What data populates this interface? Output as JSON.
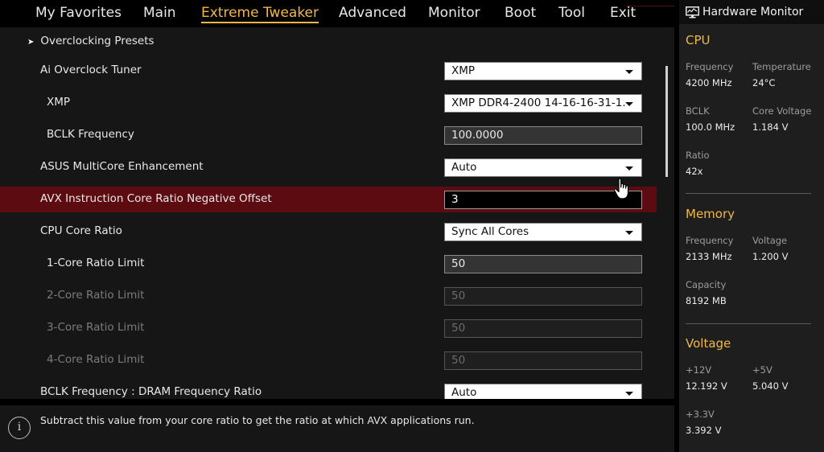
{
  "menu": {
    "tabs": [
      {
        "label": "My Favorites",
        "active": false
      },
      {
        "label": "Main",
        "active": false
      },
      {
        "label": "Extreme Tweaker",
        "active": true
      },
      {
        "label": "Advanced",
        "active": false
      },
      {
        "label": "Monitor",
        "active": false
      },
      {
        "label": "Boot",
        "active": false
      },
      {
        "label": "Tool",
        "active": false
      },
      {
        "label": "Exit",
        "active": false
      }
    ]
  },
  "main": {
    "preset": "Overclocking Presets",
    "rows": [
      {
        "label": "Ai Overclock Tuner",
        "control": "select",
        "value": "XMP"
      },
      {
        "label": "XMP",
        "control": "select",
        "value": "XMP DDR4-2400 14-16-16-31-1."
      },
      {
        "label": "BCLK Frequency",
        "control": "input",
        "value": "100.0000"
      },
      {
        "label": "ASUS MultiCore Enhancement",
        "control": "select",
        "value": "Auto"
      },
      {
        "label": "AVX Instruction Core Ratio Negative Offset",
        "control": "input",
        "value": "3",
        "selected": true
      },
      {
        "label": "CPU Core Ratio",
        "control": "select",
        "value": "Sync All Cores"
      },
      {
        "label": "1-Core Ratio Limit",
        "control": "input",
        "value": "50"
      },
      {
        "label": "2-Core Ratio Limit",
        "control": "input",
        "value": "50",
        "disabled": true
      },
      {
        "label": "3-Core Ratio Limit",
        "control": "input",
        "value": "50",
        "disabled": true
      },
      {
        "label": "4-Core Ratio Limit",
        "control": "input",
        "value": "50",
        "disabled": true
      },
      {
        "label": "BCLK Frequency : DRAM Frequency Ratio",
        "control": "select",
        "value": "Auto"
      }
    ]
  },
  "help": {
    "icon": "info-icon",
    "text": "Subtract this value from your core ratio to get the ratio at which AVX applications run."
  },
  "hardware_monitor": {
    "title": "Hardware Monitor",
    "cpu": {
      "title": "CPU",
      "frequency_label": "Frequency",
      "frequency": "4200 MHz",
      "temperature_label": "Temperature",
      "temperature": "24°C",
      "bclk_label": "BCLK",
      "bclk": "100.0 MHz",
      "core_voltage_label": "Core Voltage",
      "core_voltage": "1.184 V",
      "ratio_label": "Ratio",
      "ratio": "42x"
    },
    "memory": {
      "title": "Memory",
      "frequency_label": "Frequency",
      "frequency": "2133 MHz",
      "voltage_label": "Voltage",
      "voltage": "1.200 V",
      "capacity_label": "Capacity",
      "capacity": "8192 MB"
    },
    "voltage": {
      "title": "Voltage",
      "v12_label": "+12V",
      "v12": "12.192 V",
      "v5_label": "+5V",
      "v5": "5.040 V",
      "v33_label": "+3.3V",
      "v33": "3.392 V"
    }
  },
  "colors": {
    "accent": "#f0b848",
    "highlight": "#5c0c10"
  }
}
